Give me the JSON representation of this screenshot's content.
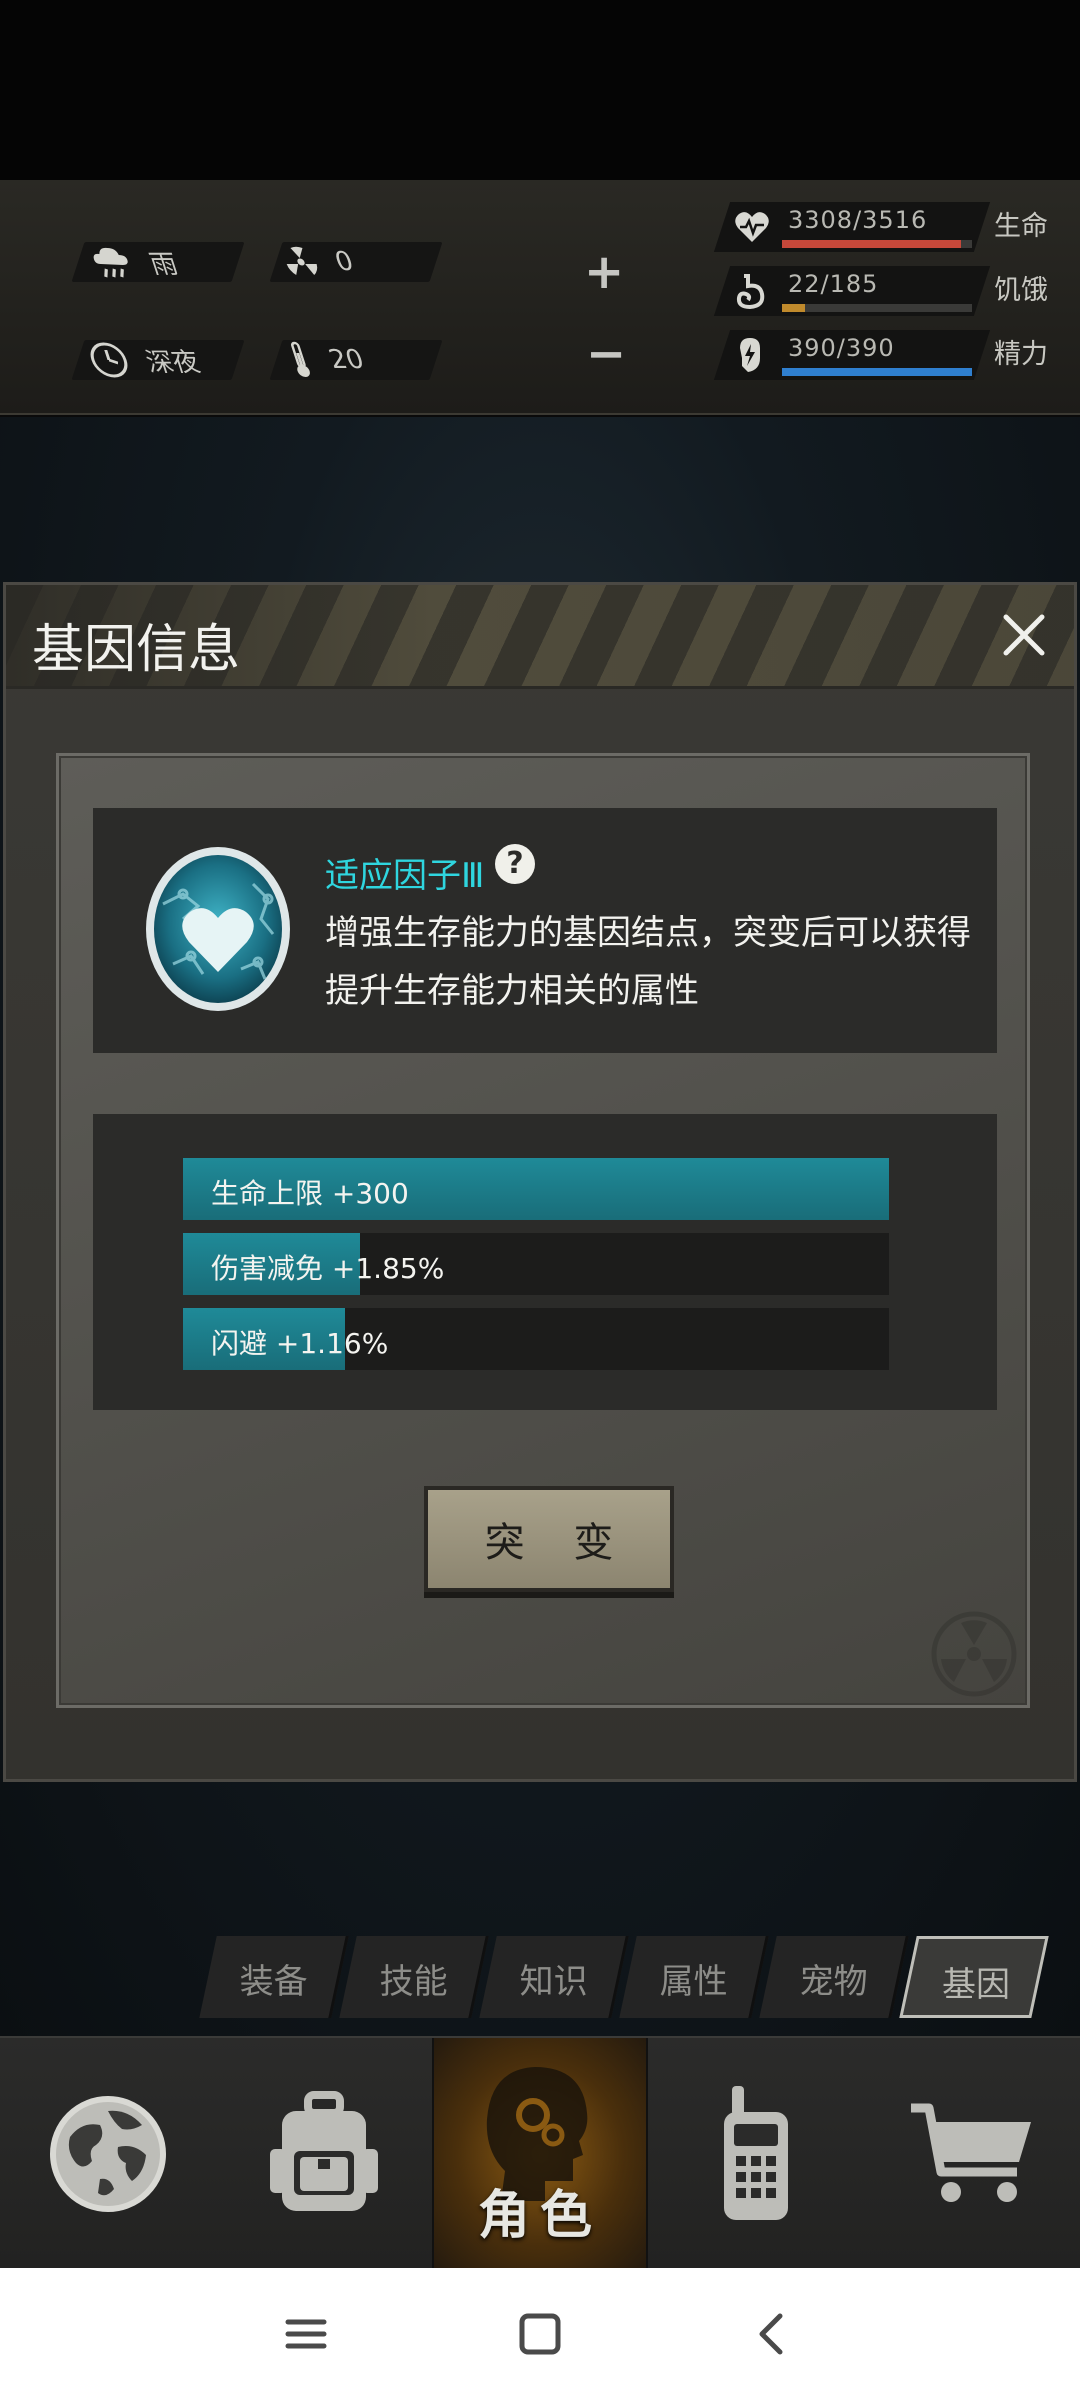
{
  "status": {
    "weather": "雨",
    "radiation": "0",
    "time_of_day": "深夜",
    "temperature": "20",
    "vitals": [
      {
        "name": "生命",
        "value": "3308/3516",
        "fraction": 0.94,
        "color": "#c6483a",
        "icon": "heart-pulse-icon"
      },
      {
        "name": "饥饿",
        "value": "22/185",
        "fraction": 0.12,
        "color": "#c08a2c",
        "icon": "stomach-icon"
      },
      {
        "name": "精力",
        "value": "390/390",
        "fraction": 1.0,
        "color": "#2f7fcf",
        "icon": "energy-icon"
      }
    ]
  },
  "dialog": {
    "title": "基因信息",
    "gene_name": "适应因子Ⅲ",
    "help_symbol": "?",
    "description": "增强生存能力的基因结点，突变后可以获得提升生存能力相关的属性",
    "attributes": [
      {
        "label": "生命上限 +300",
        "fraction": 1.0
      },
      {
        "label": "伤害减免 +1.85%",
        "fraction": 0.25
      },
      {
        "label": "闪避 +1.16%",
        "fraction": 0.23
      }
    ],
    "mutate_button": "突 变"
  },
  "tabs": [
    {
      "label": "装备"
    },
    {
      "label": "技能"
    },
    {
      "label": "知识"
    },
    {
      "label": "属性"
    },
    {
      "label": "宠物"
    },
    {
      "label": "基因",
      "active": true
    }
  ],
  "bottom_nav": [
    {
      "name": "world",
      "icon": "globe-icon"
    },
    {
      "name": "backpack",
      "icon": "backpack-icon"
    },
    {
      "name": "character",
      "icon": "head-icon",
      "label": "角色",
      "active": true
    },
    {
      "name": "radio",
      "icon": "walkie-talkie-icon"
    },
    {
      "name": "shop",
      "icon": "cart-icon"
    }
  ],
  "colors": {
    "accent_teal": "#2fd6df",
    "bar_teal": "#1f8a98",
    "button_tan": "#a8a18a"
  }
}
